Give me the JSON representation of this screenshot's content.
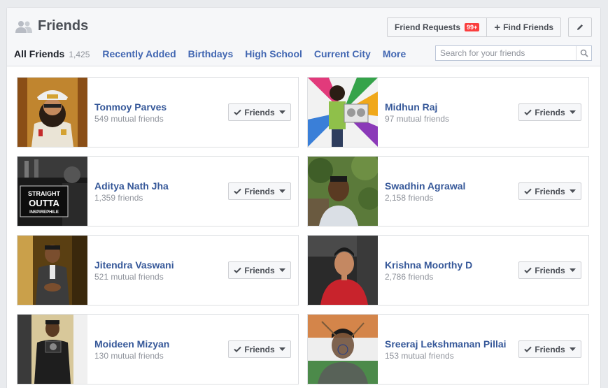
{
  "header": {
    "title": "Friends",
    "friend_requests_label": "Friend Requests",
    "friend_requests_badge": "99+",
    "find_friends_label": "Find Friends"
  },
  "tabs": {
    "all_friends_label": "All Friends",
    "all_friends_count": "1,425",
    "items": [
      "Recently Added",
      "Birthdays",
      "High School",
      "Current City",
      "More"
    ]
  },
  "search": {
    "placeholder": "Search for your friends"
  },
  "friends": [
    {
      "name": "Tonmoy Parves",
      "subtitle": "549 mutual friends",
      "button": "Friends"
    },
    {
      "name": "Midhun Raj",
      "subtitle": "97 mutual friends",
      "button": "Friends"
    },
    {
      "name": "Aditya Nath Jha",
      "subtitle": "1,359 friends",
      "button": "Friends"
    },
    {
      "name": "Swadhin Agrawal",
      "subtitle": "2,158 friends",
      "button": "Friends"
    },
    {
      "name": "Jitendra Vaswani",
      "subtitle": "521 mutual friends",
      "button": "Friends"
    },
    {
      "name": "Krishna Moorthy D",
      "subtitle": "2,786 friends",
      "button": "Friends"
    },
    {
      "name": "Moideen Mizyan",
      "subtitle": "130 mutual friends",
      "button": "Friends"
    },
    {
      "name": "Sreeraj Lekshmanan Pillai",
      "subtitle": "153 mutual friends",
      "button": "Friends"
    }
  ],
  "photo_text": {
    "aditya_poster": "STRAIGHT OUTTA INSPIREPHILE"
  },
  "colors": {
    "link": "#365899",
    "tab_link": "#4267b2",
    "badge": "#fa3e3e",
    "muted": "#90949c"
  }
}
